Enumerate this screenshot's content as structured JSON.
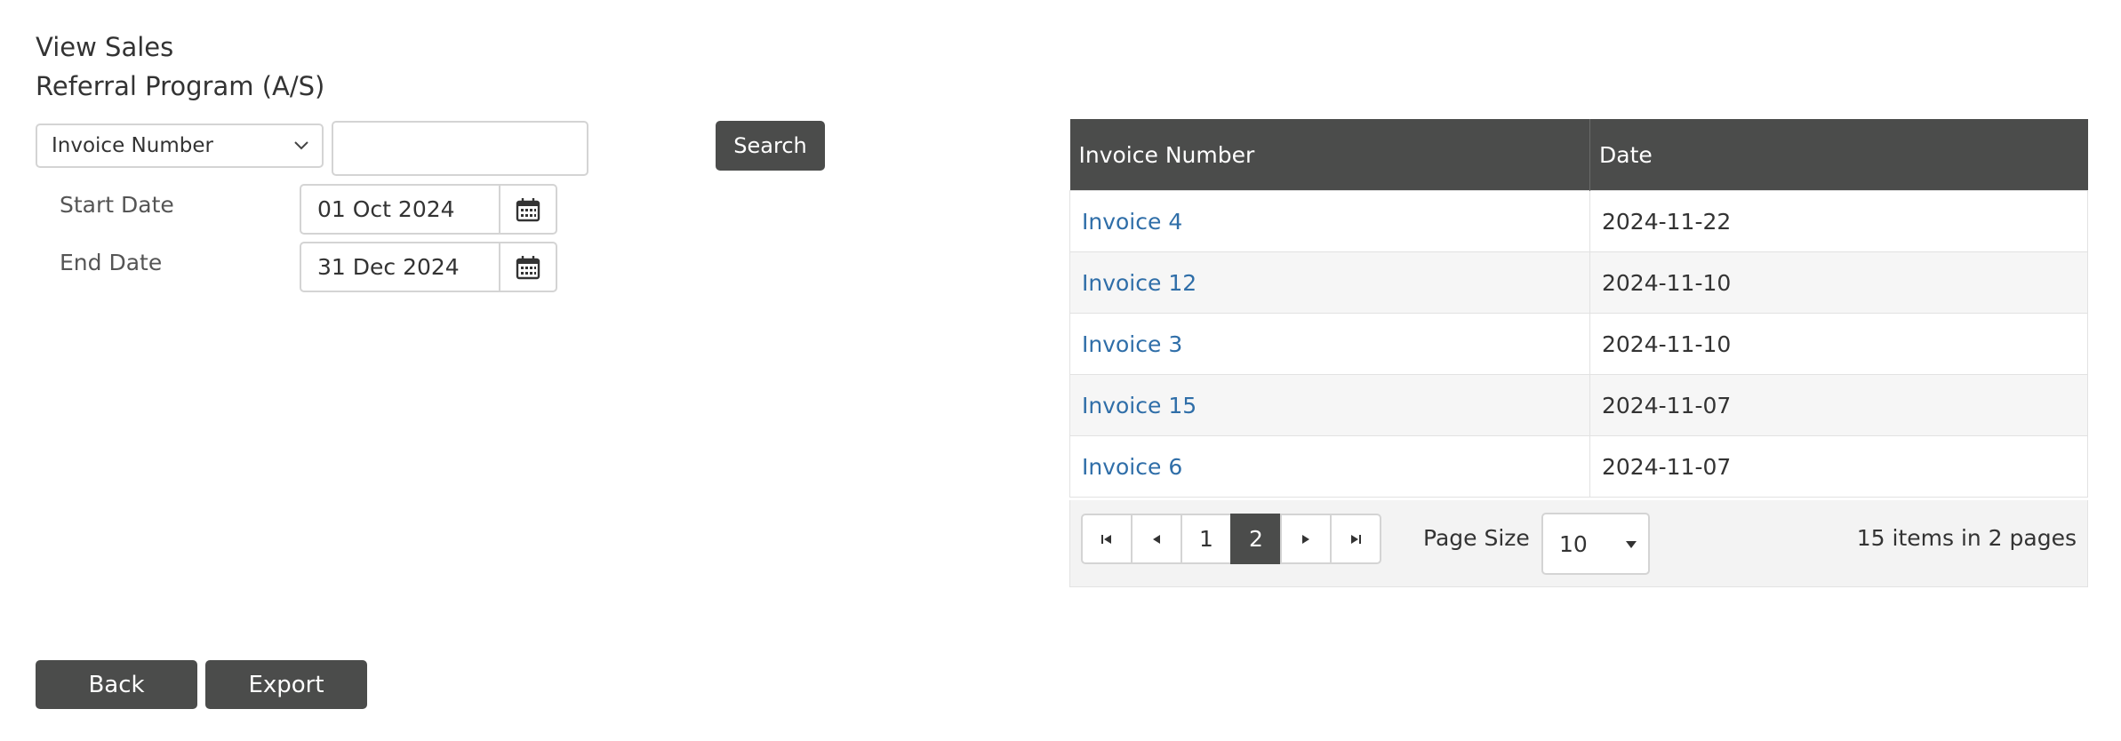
{
  "header": {
    "title": "View Sales",
    "subtitle": "Referral Program (A/S)"
  },
  "filter": {
    "field_select_value": "Invoice Number",
    "search_value": "",
    "search_button": "Search",
    "start_date_label": "Start Date",
    "start_date_value": "01 Oct 2024",
    "end_date_label": "End Date",
    "end_date_value": "31 Dec 2024"
  },
  "grid": {
    "columns": [
      "Invoice Number",
      "Date"
    ],
    "rows": [
      {
        "invoice": "Invoice 4",
        "date": "2024-11-22"
      },
      {
        "invoice": "Invoice 12",
        "date": "2024-11-10"
      },
      {
        "invoice": "Invoice 3",
        "date": "2024-11-10"
      },
      {
        "invoice": "Invoice 15",
        "date": "2024-11-07"
      },
      {
        "invoice": "Invoice 6",
        "date": "2024-11-07"
      }
    ]
  },
  "pager": {
    "pages": [
      "1",
      "2"
    ],
    "current_page": "2",
    "page_size_label": "Page Size",
    "page_size_value": "10",
    "info": "15 items in 2 pages"
  },
  "actions": {
    "back": "Back",
    "export": "Export"
  },
  "icons": {
    "calendar": "calendar-icon",
    "chevron": "chevron-down-icon",
    "first": "first-page-icon",
    "prev": "prev-page-icon",
    "next": "next-page-icon",
    "last": "last-page-icon"
  },
  "colors": {
    "dark": "#4b4c4b",
    "link": "#2f6ea8",
    "alt_row": "#f6f6f6"
  }
}
